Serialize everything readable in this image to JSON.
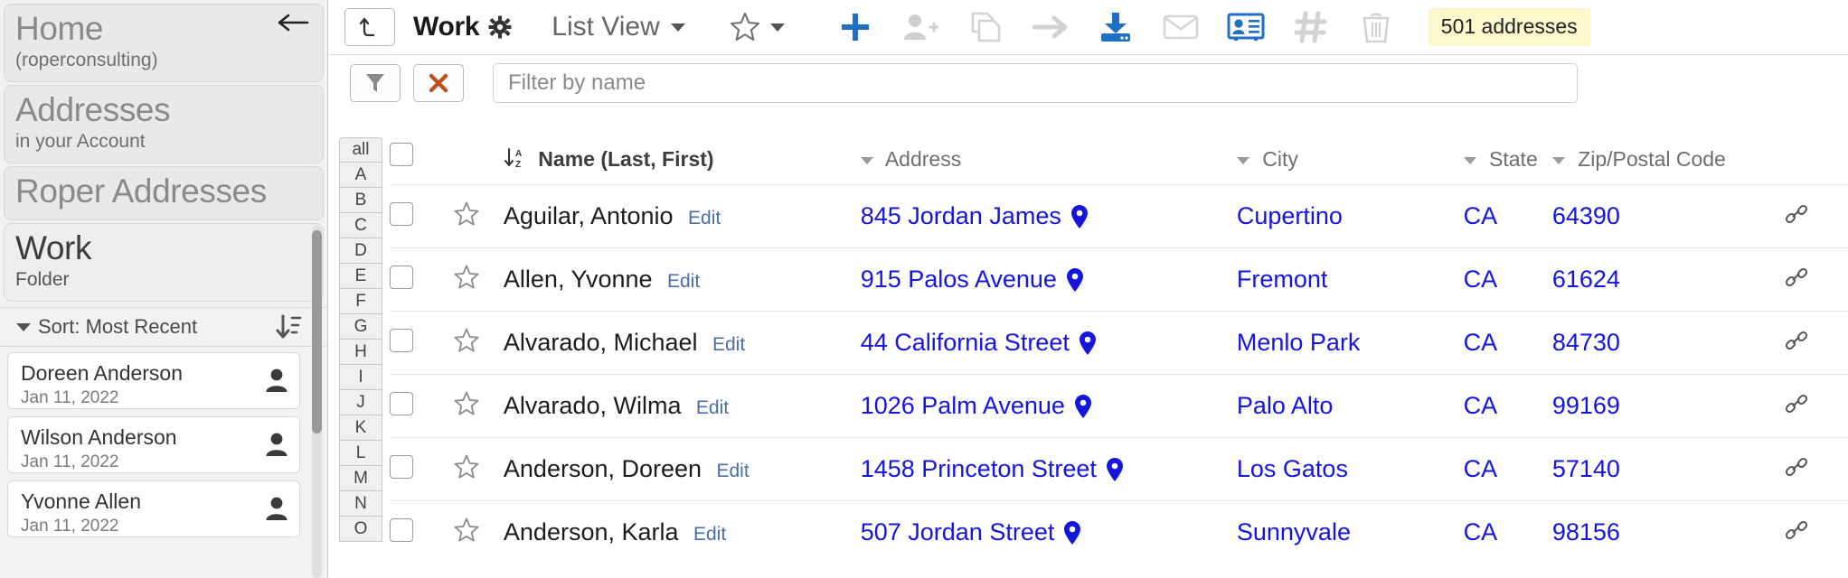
{
  "sidebar": {
    "breadcrumbs": [
      {
        "title": "Home",
        "subtitle": "(roperconsulting)",
        "active": false
      },
      {
        "title": "Addresses",
        "subtitle": "in your Account",
        "active": false
      },
      {
        "title": "Roper Addresses",
        "subtitle": "",
        "active": false
      },
      {
        "title": "Work",
        "subtitle": "Folder",
        "active": true
      }
    ],
    "sort_label": "Sort: Most Recent",
    "contacts": [
      {
        "name": "Doreen Anderson",
        "date": "Jan 11, 2022"
      },
      {
        "name": "Wilson Anderson",
        "date": "Jan 11, 2022"
      },
      {
        "name": "Yvonne Allen",
        "date": "Jan 11, 2022"
      }
    ]
  },
  "toolbar": {
    "up_button_icon": "arrow-turn-up-icon",
    "title": "Work",
    "gear_icon": "gear-icon",
    "view_selector": "List View",
    "favorites_icon": "star-icon",
    "actions": [
      {
        "name": "add-button",
        "icon": "plus-icon",
        "enabled": true
      },
      {
        "name": "add-person-button",
        "icon": "user-plus-icon",
        "enabled": false
      },
      {
        "name": "copy-button",
        "icon": "copy-icon",
        "enabled": false
      },
      {
        "name": "move-button",
        "icon": "arrow-right-icon",
        "enabled": false
      },
      {
        "name": "import-button",
        "icon": "download-icon",
        "enabled": true
      },
      {
        "name": "email-button",
        "icon": "envelope-icon",
        "enabled": false
      },
      {
        "name": "vcard-button",
        "icon": "contact-card-icon",
        "enabled": true
      },
      {
        "name": "tag-button",
        "icon": "hash-icon",
        "enabled": false
      },
      {
        "name": "delete-button",
        "icon": "trash-icon",
        "enabled": false
      }
    ],
    "count_badge": "501 addresses"
  },
  "filter_bar": {
    "filter_icon": "funnel-icon",
    "clear_icon": "x-icon",
    "placeholder": "Filter by name",
    "value": ""
  },
  "alpha_index": [
    "all",
    "A",
    "B",
    "C",
    "D",
    "E",
    "F",
    "G",
    "H",
    "I",
    "J",
    "K",
    "L",
    "M",
    "N",
    "O"
  ],
  "table": {
    "headers": {
      "name": "Name (Last, First)",
      "address": "Address",
      "city": "City",
      "state": "State",
      "zip": "Zip/Postal Code"
    },
    "edit_label": "Edit",
    "rows": [
      {
        "name": "Aguilar, Antonio",
        "address": "845 Jordan James",
        "city": "Cupertino",
        "state": "CA",
        "zip": "64390"
      },
      {
        "name": "Allen, Yvonne",
        "address": "915 Palos Avenue",
        "city": "Fremont",
        "state": "CA",
        "zip": "61624"
      },
      {
        "name": "Alvarado, Michael",
        "address": "44 California Street",
        "city": "Menlo Park",
        "state": "CA",
        "zip": "84730"
      },
      {
        "name": "Alvarado, Wilma",
        "address": "1026 Palm Avenue",
        "city": "Palo Alto",
        "state": "CA",
        "zip": "99169"
      },
      {
        "name": "Anderson, Doreen",
        "address": "1458 Princeton Street",
        "city": "Los Gatos",
        "state": "CA",
        "zip": "57140"
      },
      {
        "name": "Anderson, Karla",
        "address": "507 Jordan Street",
        "city": "Sunnyvale",
        "state": "CA",
        "zip": "98156"
      }
    ]
  },
  "colors": {
    "link_blue": "#1515e0",
    "accent_blue": "#2a74c0",
    "badge_yellow": "#fbf8cd",
    "clear_orange": "#c0501a"
  }
}
